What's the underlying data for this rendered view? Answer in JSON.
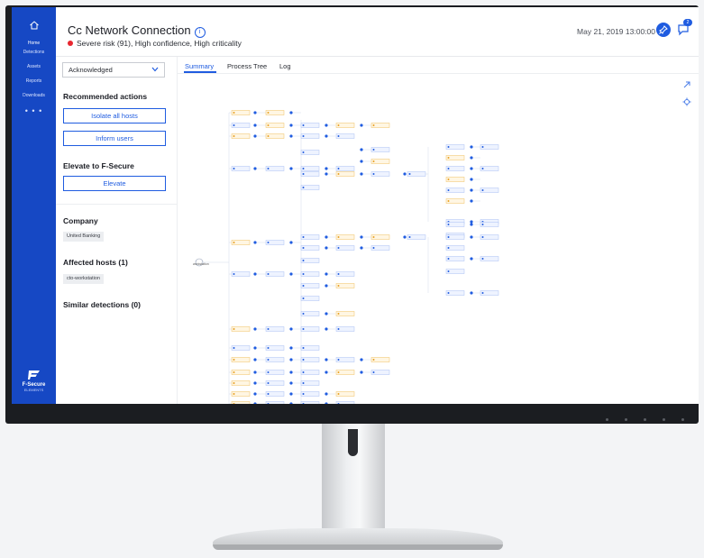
{
  "sidebar": {
    "items": [
      {
        "label": "Home"
      },
      {
        "label": "Detections"
      },
      {
        "label": "Assets"
      },
      {
        "label": "Reports"
      },
      {
        "label": "Downloads"
      }
    ],
    "more": "• • •",
    "brand": "F-Secure",
    "brand_sub": "ELEMENTS"
  },
  "header": {
    "title": "Cc Network Connection",
    "risk": "Severe risk (91), High confidence, High criticality",
    "date": "May 21, 2019 13:00:00",
    "notification_count": "2"
  },
  "panel": {
    "status": "Acknowledged",
    "recommended_title": "Recommended actions",
    "isolate_label": "Isolate all hosts",
    "inform_label": "Inform users",
    "elevate_title": "Elevate to F-Secure",
    "elevate_label": "Elevate",
    "company_title": "Company",
    "company_value": "United Banking",
    "affected_title": "Affected hosts (1)",
    "affected_value": "cto-workstation",
    "similar_title": "Similar detections (0)"
  },
  "tabs": [
    {
      "label": "Summary"
    },
    {
      "label": "Process Tree"
    },
    {
      "label": "Log"
    }
  ],
  "graph": {
    "root_label": "workstation"
  },
  "colors": {
    "brand_blue": "#1648c4",
    "accent": "#1f5ce0",
    "risk_red": "#e8262f"
  }
}
